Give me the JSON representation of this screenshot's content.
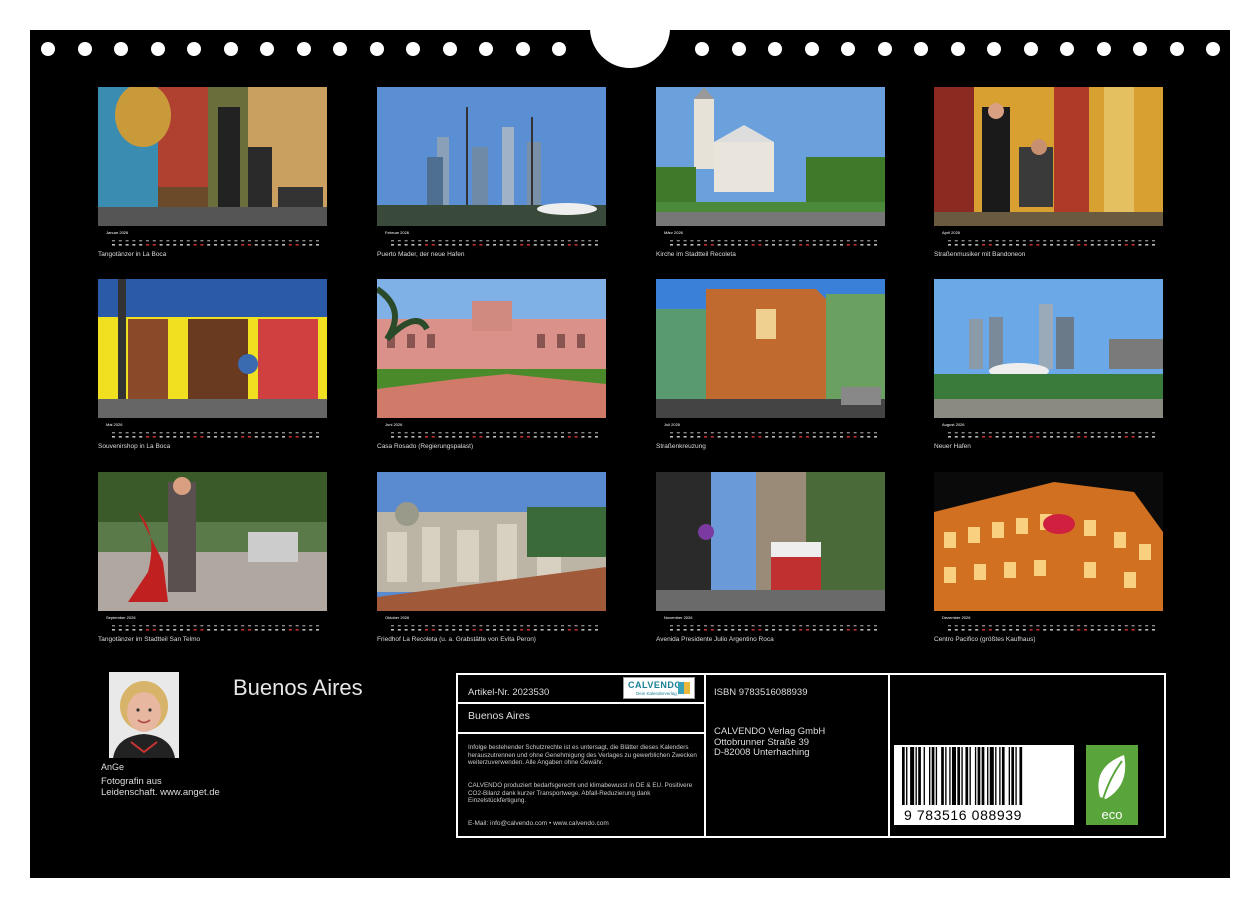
{
  "calendar_title": "Buenos Aires",
  "author": {
    "name": "AnGe",
    "bio_line1": "Fotografin aus",
    "bio_line2": "Leidenschaft. www.anget.de"
  },
  "months": [
    {
      "name": "Januar 2026",
      "caption": "Tangotänzer in La Boca"
    },
    {
      "name": "Februar 2026",
      "caption": "Puerto Mader, der neue Hafen"
    },
    {
      "name": "März 2026",
      "caption": "Kirche im Stadtteil Recoleta"
    },
    {
      "name": "April 2026",
      "caption": "Straßenmusiker mit Bandoneon"
    },
    {
      "name": "Mai 2026",
      "caption": "Souvenirshop in La Boca"
    },
    {
      "name": "Juni 2026",
      "caption": "Casa Rosado (Regierungspalast)"
    },
    {
      "name": "Juli 2026",
      "caption": "Straßenkreuzung"
    },
    {
      "name": "August 2026",
      "caption": "Neuer Hafen"
    },
    {
      "name": "September 2026",
      "caption": "Tangotänzer im Stadtteil San Telmo"
    },
    {
      "name": "Oktober 2026",
      "caption": "Friedhof La Recoleta (u. a. Grabstätte von Evita Peron)"
    },
    {
      "name": "November 2026",
      "caption": "Avenida Presidente Julio Argentino Roca"
    },
    {
      "name": "Dezember 2026",
      "caption": "Centro Pacifico (größtes Kaufhaus)"
    }
  ],
  "info": {
    "article": "Artikel-Nr. 2023530",
    "book_name": "Buenos Aires",
    "legal1": "Infolge bestehender Schutzrechte ist es untersagt, die Blätter dieses Kalenders herauszutrennen und ohne Genehmigung des Verlages zu gewerblichen Zwecken weiterzuverwenden. Alle Angaben ohne Gewähr.",
    "legal2": "CALVENDO produziert bedarfsgerecht und klimabewusst in DE & EU. Positivere CO2-Bilanz dank kurzer Transportwege. Abfall-Reduzierung dank Einzelstückfertigung.",
    "email": "E-Mail: info@calvendo.com • www.calvendo.com",
    "logo_text": "CALVENDO",
    "logo_sub": "Dein Kalenderverlag",
    "isbn": "ISBN 9783516088939",
    "publisher1": "CALVENDO Verlag GmbH",
    "publisher2": "Ottobrunner Straße 39",
    "publisher3": "D-82008 Unterhaching",
    "barcode_number": "9 783516 088939",
    "eco_label": "eco"
  }
}
